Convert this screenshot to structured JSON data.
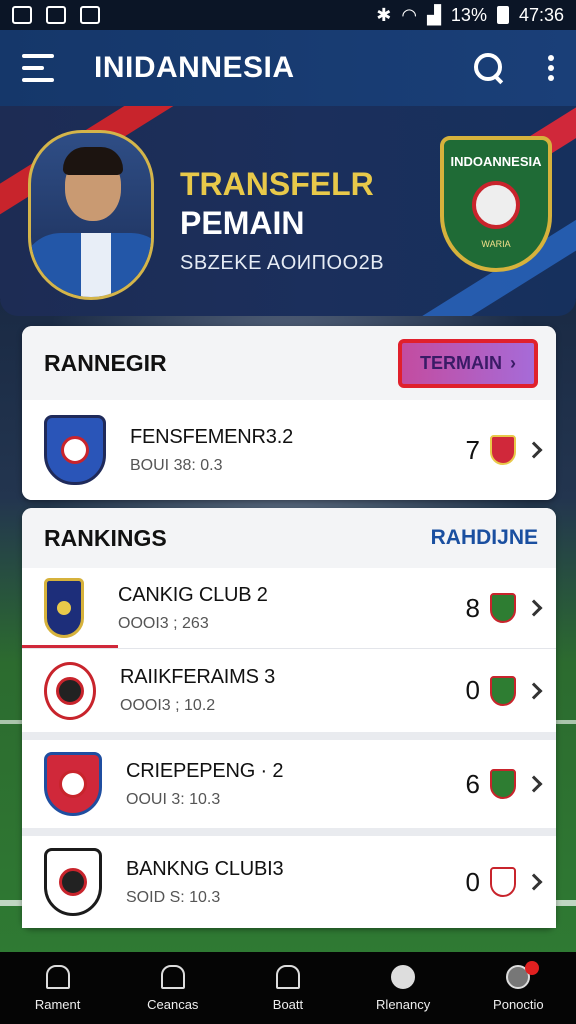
{
  "status_bar": {
    "battery": "13%",
    "time": "47:36"
  },
  "app_bar": {
    "title": "INIDANNESIA"
  },
  "hero": {
    "line1": "TRANSFELR",
    "line2": "PEMAIN",
    "line3": "SBZEKE AOИПOО2B",
    "crest_text": "INDOANNESIA",
    "crest_bottom": "WARIA"
  },
  "transfer_section": {
    "title": "RANNEGIR",
    "button_label": "TERMAIN",
    "items": [
      {
        "name": "FENSFEMENR3.2",
        "sub": "BOUI 38: 0.3",
        "count": "7"
      }
    ]
  },
  "rankings_section": {
    "title": "RANKINGS",
    "link_label": "RAHDIJNE",
    "items": [
      {
        "name": "CANKIG CLUB   2",
        "sub": "OOOI3 ; 263",
        "count": "8"
      },
      {
        "name": "RAIIKFERAIMS 3",
        "sub": "OOOI3 ; 10.2",
        "count": "0"
      },
      {
        "name": "CRIEPEPENG · 2",
        "sub": "OOUI 3: 10.3",
        "count": "6"
      },
      {
        "name": "BANKNG CLUBI3",
        "sub": "SOID S: 10.3",
        "count": "0"
      }
    ]
  },
  "bottom_nav": {
    "items": [
      {
        "label": "Rament",
        "icon": "home-icon"
      },
      {
        "label": "Ceancas",
        "icon": "home-outline-icon"
      },
      {
        "label": "Boatt",
        "icon": "house-icon"
      },
      {
        "label": "Rlenancy",
        "icon": "heart-icon"
      },
      {
        "label": "Ponoctio",
        "icon": "alert-icon"
      }
    ]
  },
  "colors": {
    "app_bar": "#15376a",
    "accent_gold": "#e8c94a",
    "accent_red": "#d0283a",
    "link_blue": "#1a4fa0"
  }
}
